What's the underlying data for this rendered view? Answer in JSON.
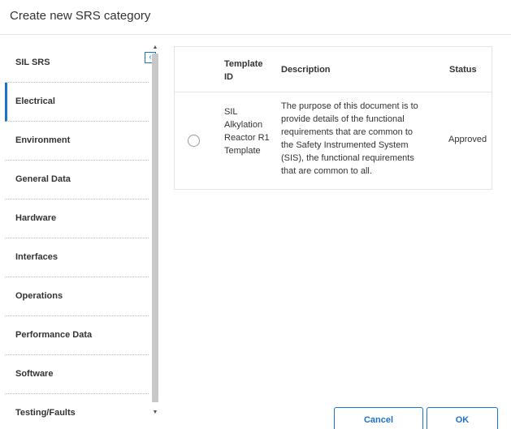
{
  "dialog": {
    "title": "Create new SRS category"
  },
  "sidebar": {
    "items": [
      {
        "label": "SIL SRS"
      },
      {
        "label": "Electrical"
      },
      {
        "label": "Environment"
      },
      {
        "label": "General Data"
      },
      {
        "label": "Hardware"
      },
      {
        "label": "Interfaces"
      },
      {
        "label": "Operations"
      },
      {
        "label": "Performance Data"
      },
      {
        "label": "Software"
      },
      {
        "label": "Testing/Faults"
      }
    ],
    "active_index": 1,
    "collapse_icon": "chevron-left-icon"
  },
  "table": {
    "columns": {
      "template_id": "Template ID",
      "description": "Description",
      "status": "Status"
    },
    "rows": [
      {
        "template_id": "SIL Alkylation Reactor R1 Template",
        "description": "The purpose of this document is to provide details of the functional requirements that are common to the Safety Instrumented System (SIS), the functional requirements that are common to all.",
        "status": "Approved",
        "selected": false
      }
    ]
  },
  "footer": {
    "cancel_label": "Cancel",
    "ok_label": "OK"
  },
  "colors": {
    "accent": "#1a73c9",
    "border": "#e3e3e3",
    "text": "#333333"
  }
}
